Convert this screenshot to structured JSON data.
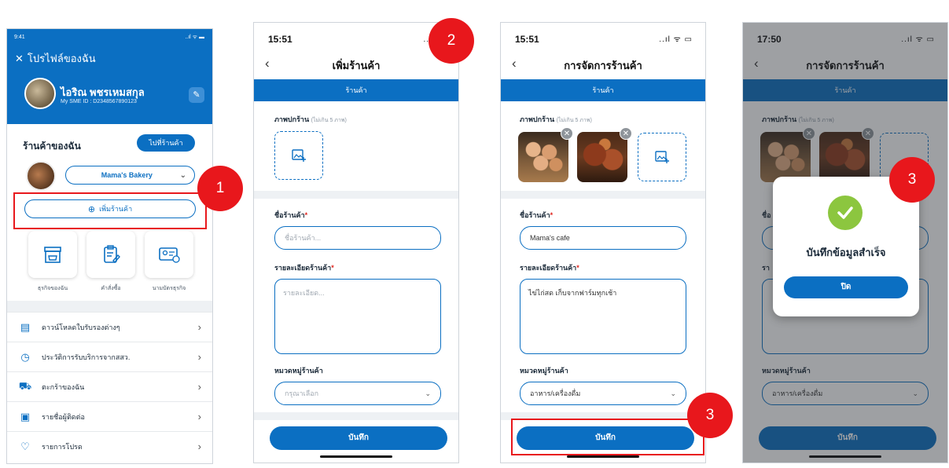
{
  "screen1": {
    "status_time": "9:41",
    "status_icons": "..ıl ᯤ ▬",
    "title": "โปรไฟล์ของฉัน",
    "user_name": "ไอริณ พชรเหมสกุล",
    "user_id": "My SME ID : D2348567890123",
    "my_shop_title": "ร้านค้าของฉัน",
    "go_shop_button": "ไปที่ร้านค้า",
    "selected_shop": "Mama's Bakery",
    "add_shop_button": "เพิ่มร้านค้า",
    "quick_actions": [
      "ธุรกิจของฉัน",
      "คำสั่งซื้อ",
      "นามบัตรธุรกิจ"
    ],
    "menu_items": [
      "ดาวน์โหลดใบรับรองต่างๆ",
      "ประวัติการรับบริการจากสสว.",
      "ตะกร้าของฉัน",
      "รายชื่อผู้ติดต่อ",
      "รายการโปรด"
    ]
  },
  "screen2": {
    "status_time": "15:51",
    "status_icons": "..ıl ᯤ",
    "title": "เพิ่มร้านค้า",
    "tab": "ร้านค้า",
    "cover_label": "ภาพปกร้าน",
    "cover_hint": "(ไม่เกิน 5 ภาพ)",
    "name_label": "ชื่อร้านค้า",
    "name_placeholder": "ชื่อร้านค้า...",
    "detail_label": "รายละเอียดร้านค้า",
    "detail_placeholder": "รายละเอียด...",
    "category_label": "หมวดหมู่ร้านค้า",
    "category_placeholder": "กรุณาเลือก",
    "save_button": "บันทึก"
  },
  "screen3": {
    "status_time": "15:51",
    "status_icons": "..ıl ᯤ ▭",
    "title": "การจัดการร้านค้า",
    "tab": "ร้านค้า",
    "cover_label": "ภาพปกร้าน",
    "cover_hint": "(ไม่เกิน 5 ภาพ)",
    "name_label": "ชื่อร้านค้า",
    "name_value": "Mama's cafe",
    "detail_label": "รายละเอียดร้านค้า",
    "detail_value": "ไข่ไก่สด เก็บจากฟาร์มทุกเช้า",
    "category_label": "หมวดหมู่ร้านค้า",
    "category_value": "อาหาร/เครื่องดื่ม",
    "save_button": "บันทึก"
  },
  "screen4": {
    "status_time": "17:50",
    "status_icons": "..ıl ᯤ ▭",
    "title": "การจัดการร้านค้า",
    "tab": "ร้านค้า",
    "cover_label": "ภาพปกร้าน",
    "cover_hint": "(ไม่เกิน 5 ภาพ)",
    "name_label_partial": "ชื่อ",
    "detail_label_partial": "รา",
    "category_label": "หมวดหมู่ร้านค้า",
    "category_value": "อาหาร/เครื่องดื่ม",
    "save_button": "บันทึก",
    "modal_message": "บันทึกข้อมูลสำเร็จ",
    "modal_button": "ปิด"
  },
  "annotations": {
    "step1": "1",
    "step2": "2",
    "step3a": "3",
    "step3b": "3"
  },
  "colors": {
    "primary": "#0b6fc2",
    "annotation_red": "#e8171c",
    "success_green": "#8cc63f"
  }
}
